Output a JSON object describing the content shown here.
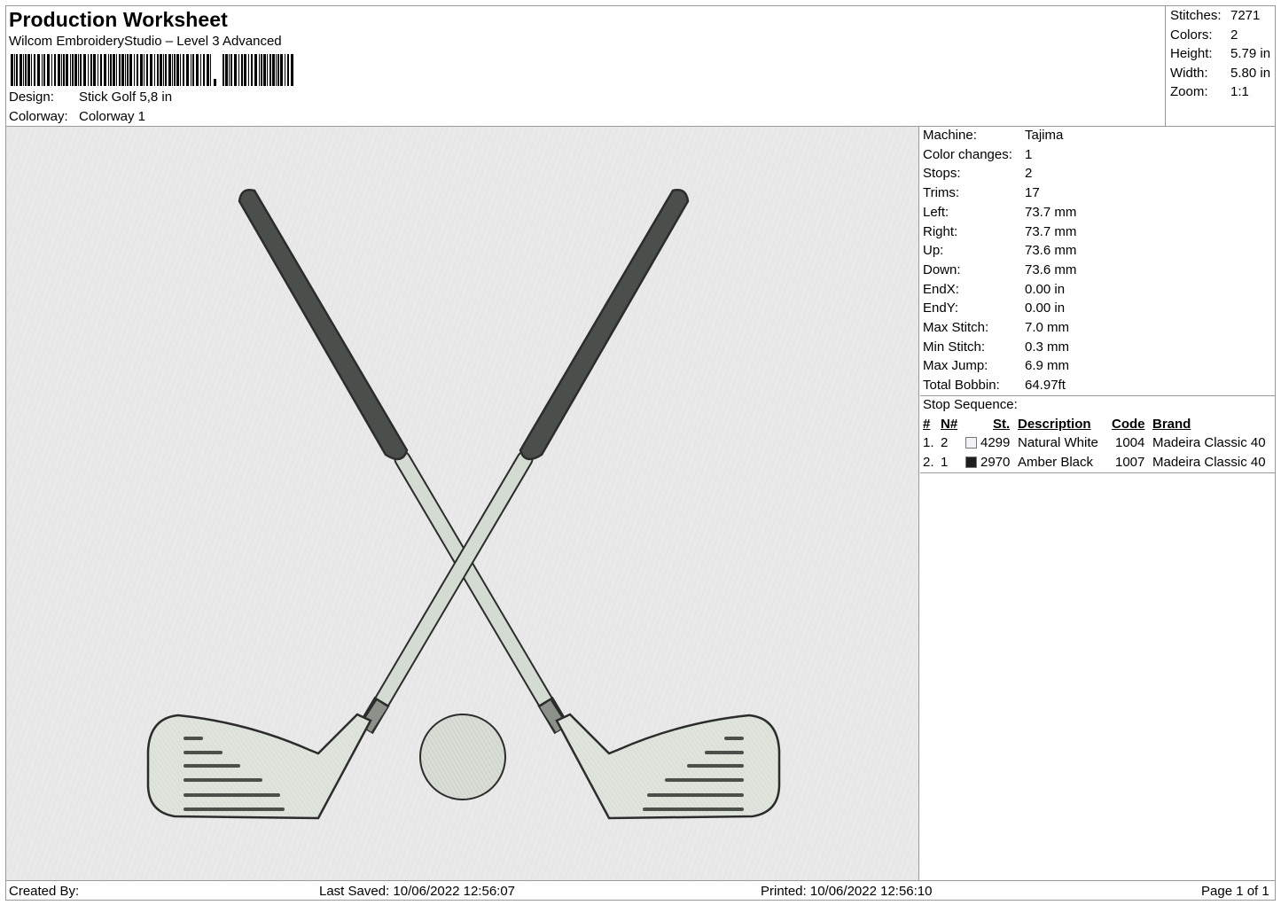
{
  "header": {
    "title": "Production Worksheet",
    "subtitle": "Wilcom EmbroideryStudio – Level 3 Advanced",
    "design_label": "Design:",
    "design_value": "Stick Golf 5,8 in",
    "colorway_label": "Colorway:",
    "colorway_value": "Colorway 1"
  },
  "stats": [
    {
      "label": "Stitches:",
      "value": "7271"
    },
    {
      "label": "Colors:",
      "value": "2"
    },
    {
      "label": "Height:",
      "value": "5.79 in"
    },
    {
      "label": "Width:",
      "value": "5.80 in"
    },
    {
      "label": "Zoom:",
      "value": "1:1"
    }
  ],
  "machine_info": [
    {
      "label": "Machine:",
      "value": "Tajima"
    },
    {
      "label": "Color changes:",
      "value": "1"
    },
    {
      "label": "Stops:",
      "value": "2"
    },
    {
      "label": "Trims:",
      "value": "17"
    },
    {
      "label": "Left:",
      "value": "73.7 mm"
    },
    {
      "label": "Right:",
      "value": "73.7 mm"
    },
    {
      "label": "Up:",
      "value": "73.6 mm"
    },
    {
      "label": "Down:",
      "value": "73.6 mm"
    },
    {
      "label": "EndX:",
      "value": "0.00 in"
    },
    {
      "label": "EndY:",
      "value": "0.00 in"
    },
    {
      "label": "Max Stitch:",
      "value": "7.0 mm"
    },
    {
      "label": "Min Stitch:",
      "value": "0.3 mm"
    },
    {
      "label": "Max Jump:",
      "value": "6.9 mm"
    },
    {
      "label": "Total Bobbin:",
      "value": "64.97ft"
    }
  ],
  "stop_sequence": {
    "label": "Stop Sequence:",
    "columns": [
      "#",
      "N#",
      "St.",
      "Description",
      "Code",
      "Brand"
    ],
    "rows": [
      {
        "num": "1.",
        "n": "2",
        "swatch": "#f2f2f4",
        "st": "4299",
        "description": "Natural White",
        "code": "1004",
        "brand": "Madeira Classic 40"
      },
      {
        "num": "2.",
        "n": "1",
        "swatch": "#1e1e1e",
        "st": "2970",
        "description": "Amber Black",
        "code": "1007",
        "brand": "Madeira Classic 40"
      }
    ]
  },
  "footer": {
    "created_by": "Created By:",
    "last_saved": "Last Saved: 10/06/2022 12:56:07",
    "printed": "Printed: 10/06/2022 12:56:10",
    "page": "Page 1 of 1"
  },
  "colors": {
    "canvas_bg": "#e9e9e9",
    "grip": "#4b4f4b",
    "shaft": "#d4dbd2",
    "head": "#dfe5dd",
    "outline": "#2c2c2c"
  }
}
